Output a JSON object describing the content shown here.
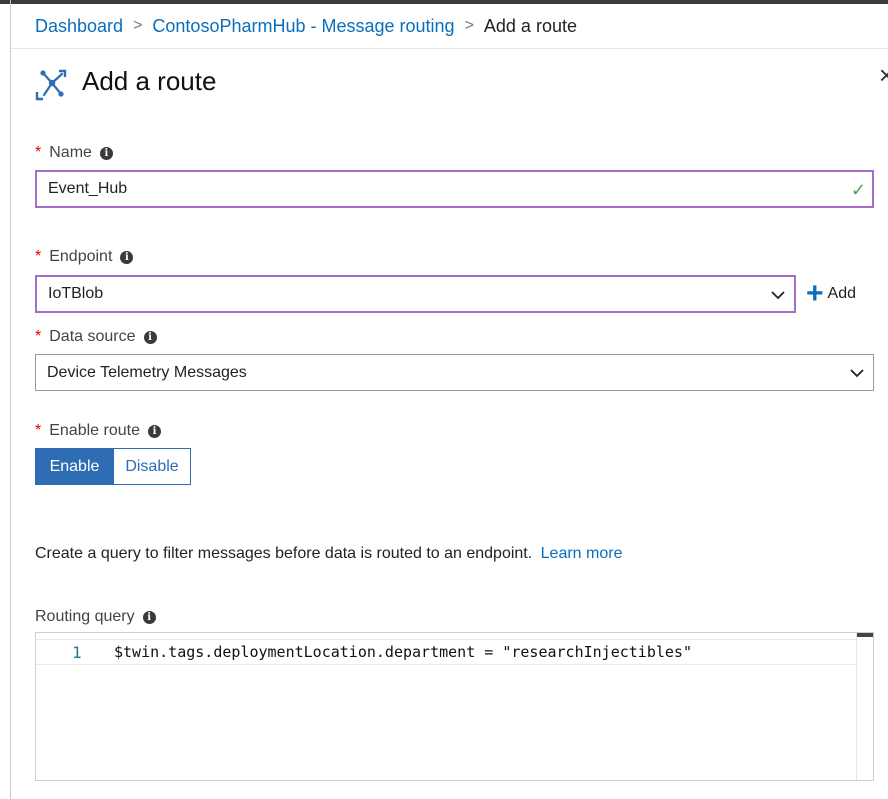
{
  "breadcrumb": {
    "items": [
      "Dashboard",
      "ContosoPharmHub - Message routing"
    ],
    "current": "Add a route",
    "separator": ">"
  },
  "header": {
    "title": "Add a route",
    "icon": "route-icon",
    "close_label": "×"
  },
  "form": {
    "name": {
      "label": "Name",
      "value": "Event_Hub",
      "valid": true
    },
    "endpoint": {
      "label": "Endpoint",
      "value": "IoTBlob",
      "add_label": "Add"
    },
    "data_source": {
      "label": "Data source",
      "value": "Device Telemetry Messages"
    },
    "enable_route": {
      "label": "Enable route",
      "options": [
        "Enable",
        "Disable"
      ],
      "selected": "Enable"
    }
  },
  "query_info": {
    "text": "Create a query to filter messages before data is routed to an endpoint.",
    "link": "Learn more"
  },
  "routing_query": {
    "label": "Routing query",
    "lines": [
      {
        "number": "1",
        "code": "$twin.tags.deploymentLocation.department = \"researchInjectibles\""
      }
    ]
  },
  "colors": {
    "accent": "#0a6ebd",
    "toggle_active": "#2e6db4",
    "valid_border": "#a56cc8",
    "required": "#e00000",
    "valid_check": "#46a34a"
  }
}
